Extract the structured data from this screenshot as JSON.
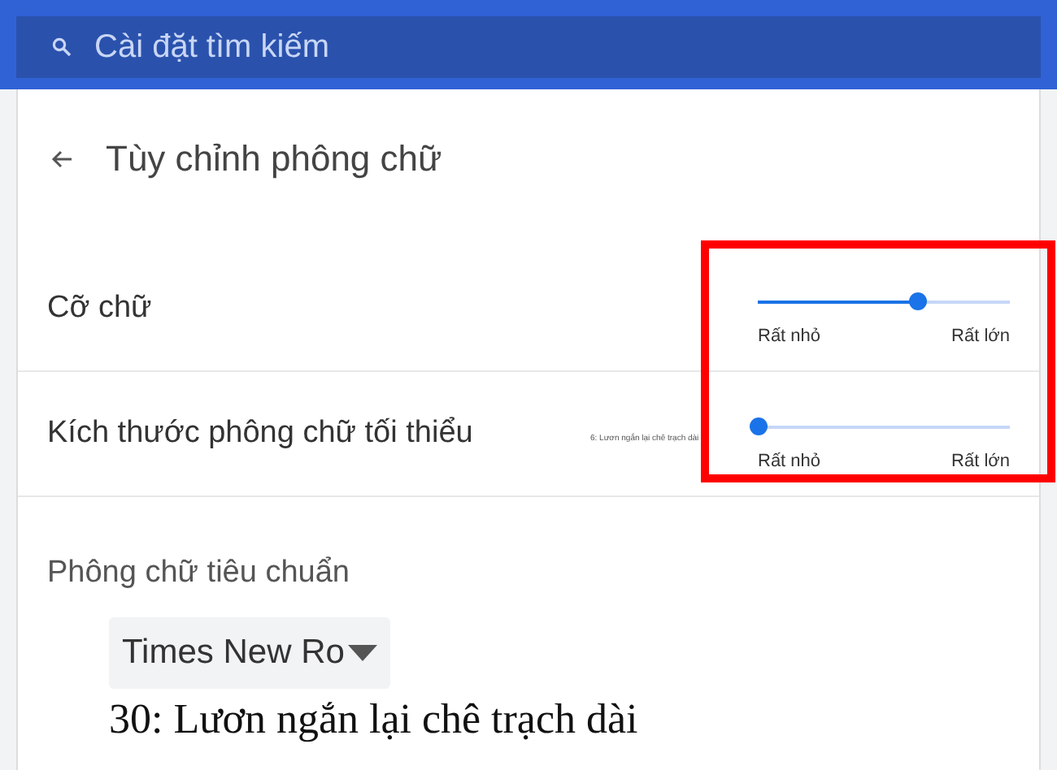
{
  "search": {
    "placeholder": "Cài đặt tìm kiếm"
  },
  "page": {
    "title": "Tùy chỉnh phông chữ"
  },
  "settings": [
    {
      "label": "Cỡ chữ",
      "level": 0.63,
      "min_label": "Rất nhỏ",
      "max_label": "Rất lớn"
    },
    {
      "label": "Kích thước phông chữ tối thiểu",
      "preview": "6: Lươn ngắn lại chê trạch dài",
      "level": 0,
      "min_label": "Rất nhỏ",
      "max_label": "Rất lớn"
    }
  ],
  "standard_font": {
    "heading": "Phông chữ tiêu chuẩn",
    "value": "Times New Ro",
    "preview": "30: Lươn ngắn lại chê trạch dài"
  }
}
